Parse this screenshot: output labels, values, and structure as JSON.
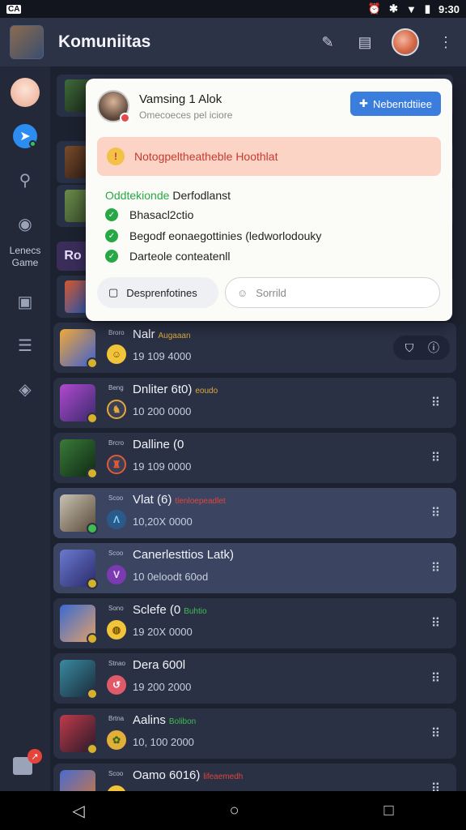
{
  "status_bar": {
    "left_badge": "CA",
    "time": "9:30"
  },
  "app_bar": {
    "title": "Komuniitas"
  },
  "sidebar": {
    "label": "Lenecs\nGame"
  },
  "bg_chip": "Ro",
  "popup": {
    "name": "Vamsing 1 Alok",
    "subtitle": "Omecoeces pel iciore",
    "button": "Nebentdtiiee",
    "alert": "Notogpeltheatheble Hoothlat",
    "check_heading_green": "Oddtekionde",
    "check_heading_dark": "Derfodlanst",
    "checks": [
      "Bhasacl2ctio",
      "Begodf eonaegottinies (ledworlodouky",
      "Darteole conteatenll"
    ],
    "footer_button": "Desprenfotines",
    "input_placeholder": "Sorrild"
  },
  "rows": [
    {
      "small": "Broro",
      "title": "Nalr",
      "tag": "Augaaan",
      "tag_color": "#e0a93a",
      "sub": "19 109 4000"
    },
    {
      "small": "Beng",
      "title": "Dnliter 6t0)",
      "tag": "eoudo",
      "tag_color": "#e0a93a",
      "sub": "10 200 0000"
    },
    {
      "small": "Brcro",
      "title": "Dalline (0",
      "tag": "",
      "tag_color": "#e0a93a",
      "sub": "19 109 0000"
    },
    {
      "small": "Scoo",
      "title": "Vlat (6)",
      "tag": "tlenloepeadlet",
      "tag_color": "#e0453a",
      "sub": "10,20X 0000"
    },
    {
      "small": "Scoo",
      "title": "Canerlesttios Latk)",
      "tag": "",
      "tag_color": "#e0a93a",
      "sub": "10 0eloodt 60od"
    },
    {
      "small": "Sono",
      "title": "Sclefe (0",
      "tag": "Buhtio",
      "tag_color": "#3fbd4f",
      "sub": "19 20X 0000"
    },
    {
      "small": "Stnao",
      "title": "Dera 600l",
      "tag": "",
      "tag_color": "#e0a93a",
      "sub": "19 200 2000"
    },
    {
      "small": "Brtna",
      "title": "Aalins",
      "tag": "Bolibon",
      "tag_color": "#3fbd4f",
      "sub": "10, 100 2000"
    },
    {
      "small": "Scoo",
      "title": "Oamo 6016)",
      "tag": "lifeaemedh",
      "tag_color": "#e0453a",
      "sub": ""
    }
  ],
  "colors": {
    "accent": "#3a7ddc",
    "alert_bg": "#fbd4c6",
    "alert_text": "#c63a2f",
    "check_green": "#27a844"
  }
}
